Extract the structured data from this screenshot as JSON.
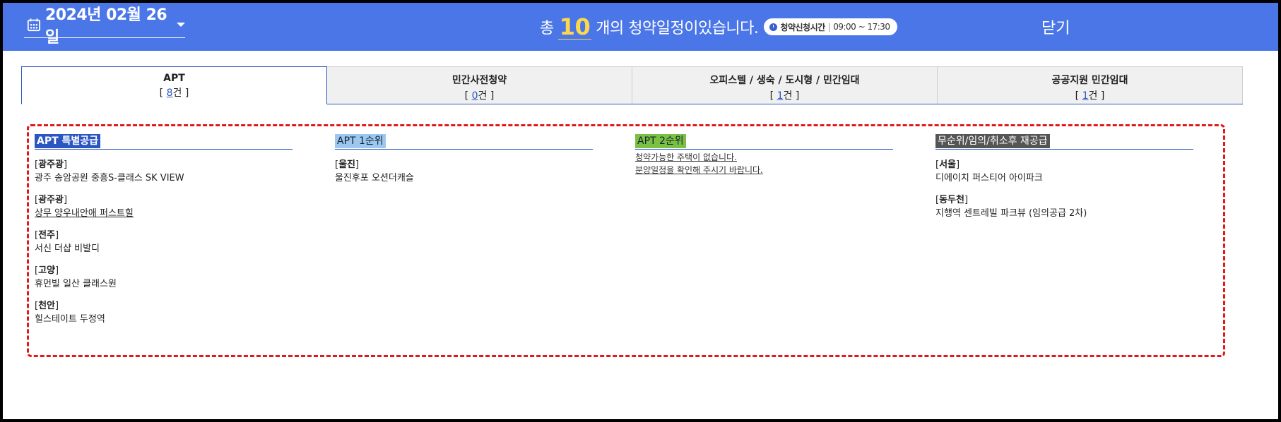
{
  "header": {
    "date": "2024년 02월 26일",
    "summary_prefix": "총",
    "summary_count": "10",
    "summary_suffix": "개의 청약일정이있습니다.",
    "badge_label": "청약신청시간",
    "badge_sep": "|",
    "badge_time": "09:00 ~ 17:30",
    "close_label": "닫기"
  },
  "tabs": [
    {
      "label": "APT",
      "count": "8",
      "open": "[ ",
      "unit": "건 ]"
    },
    {
      "label": "민간사전청약",
      "count": "0",
      "open": "[ ",
      "unit": "건 ]"
    },
    {
      "label": "오피스텔 / 생숙 / 도시형 / 민간임대",
      "count": "1",
      "open": "[ ",
      "unit": "건 ]"
    },
    {
      "label": "공공지원 민간임대",
      "count": "1",
      "open": "[ ",
      "unit": "건 ]"
    }
  ],
  "columns": {
    "special": {
      "title": "APT 특별공급",
      "items": [
        {
          "region": "광주광",
          "name": "광주 송암공원 중흥S-클래스 SK VIEW"
        },
        {
          "region": "광주광",
          "name": "상무 양우내안애 퍼스트힐"
        },
        {
          "region": "전주",
          "name": "서신 더샵 비발디"
        },
        {
          "region": "고양",
          "name": "휴먼빌 일산 클래스원"
        },
        {
          "region": "천안",
          "name": "힐스테이트 두정역"
        }
      ]
    },
    "first": {
      "title": "APT 1순위",
      "items": [
        {
          "region": "울진",
          "name": "울진후포 오션더캐슬"
        }
      ]
    },
    "second": {
      "title": "APT 2순위",
      "notice_1": "청약가능한 주택이 없습니다.",
      "notice_2": "분양일정을 확인해 주시기 바랍니다."
    },
    "nonrank": {
      "title": "무순위/임의/취소후 재공급",
      "items": [
        {
          "region": "서울",
          "name": "디에이치 퍼스티어 아이파크"
        },
        {
          "region": "동두천",
          "name": "지행역 센트레빌 파크뷰 (임의공급 2차)"
        }
      ]
    }
  },
  "colors": {
    "header_bg": "#4a76e8",
    "count_accent": "#ffd84a",
    "tab_active_border": "#2b56c2",
    "content_border": "#e0191b"
  }
}
